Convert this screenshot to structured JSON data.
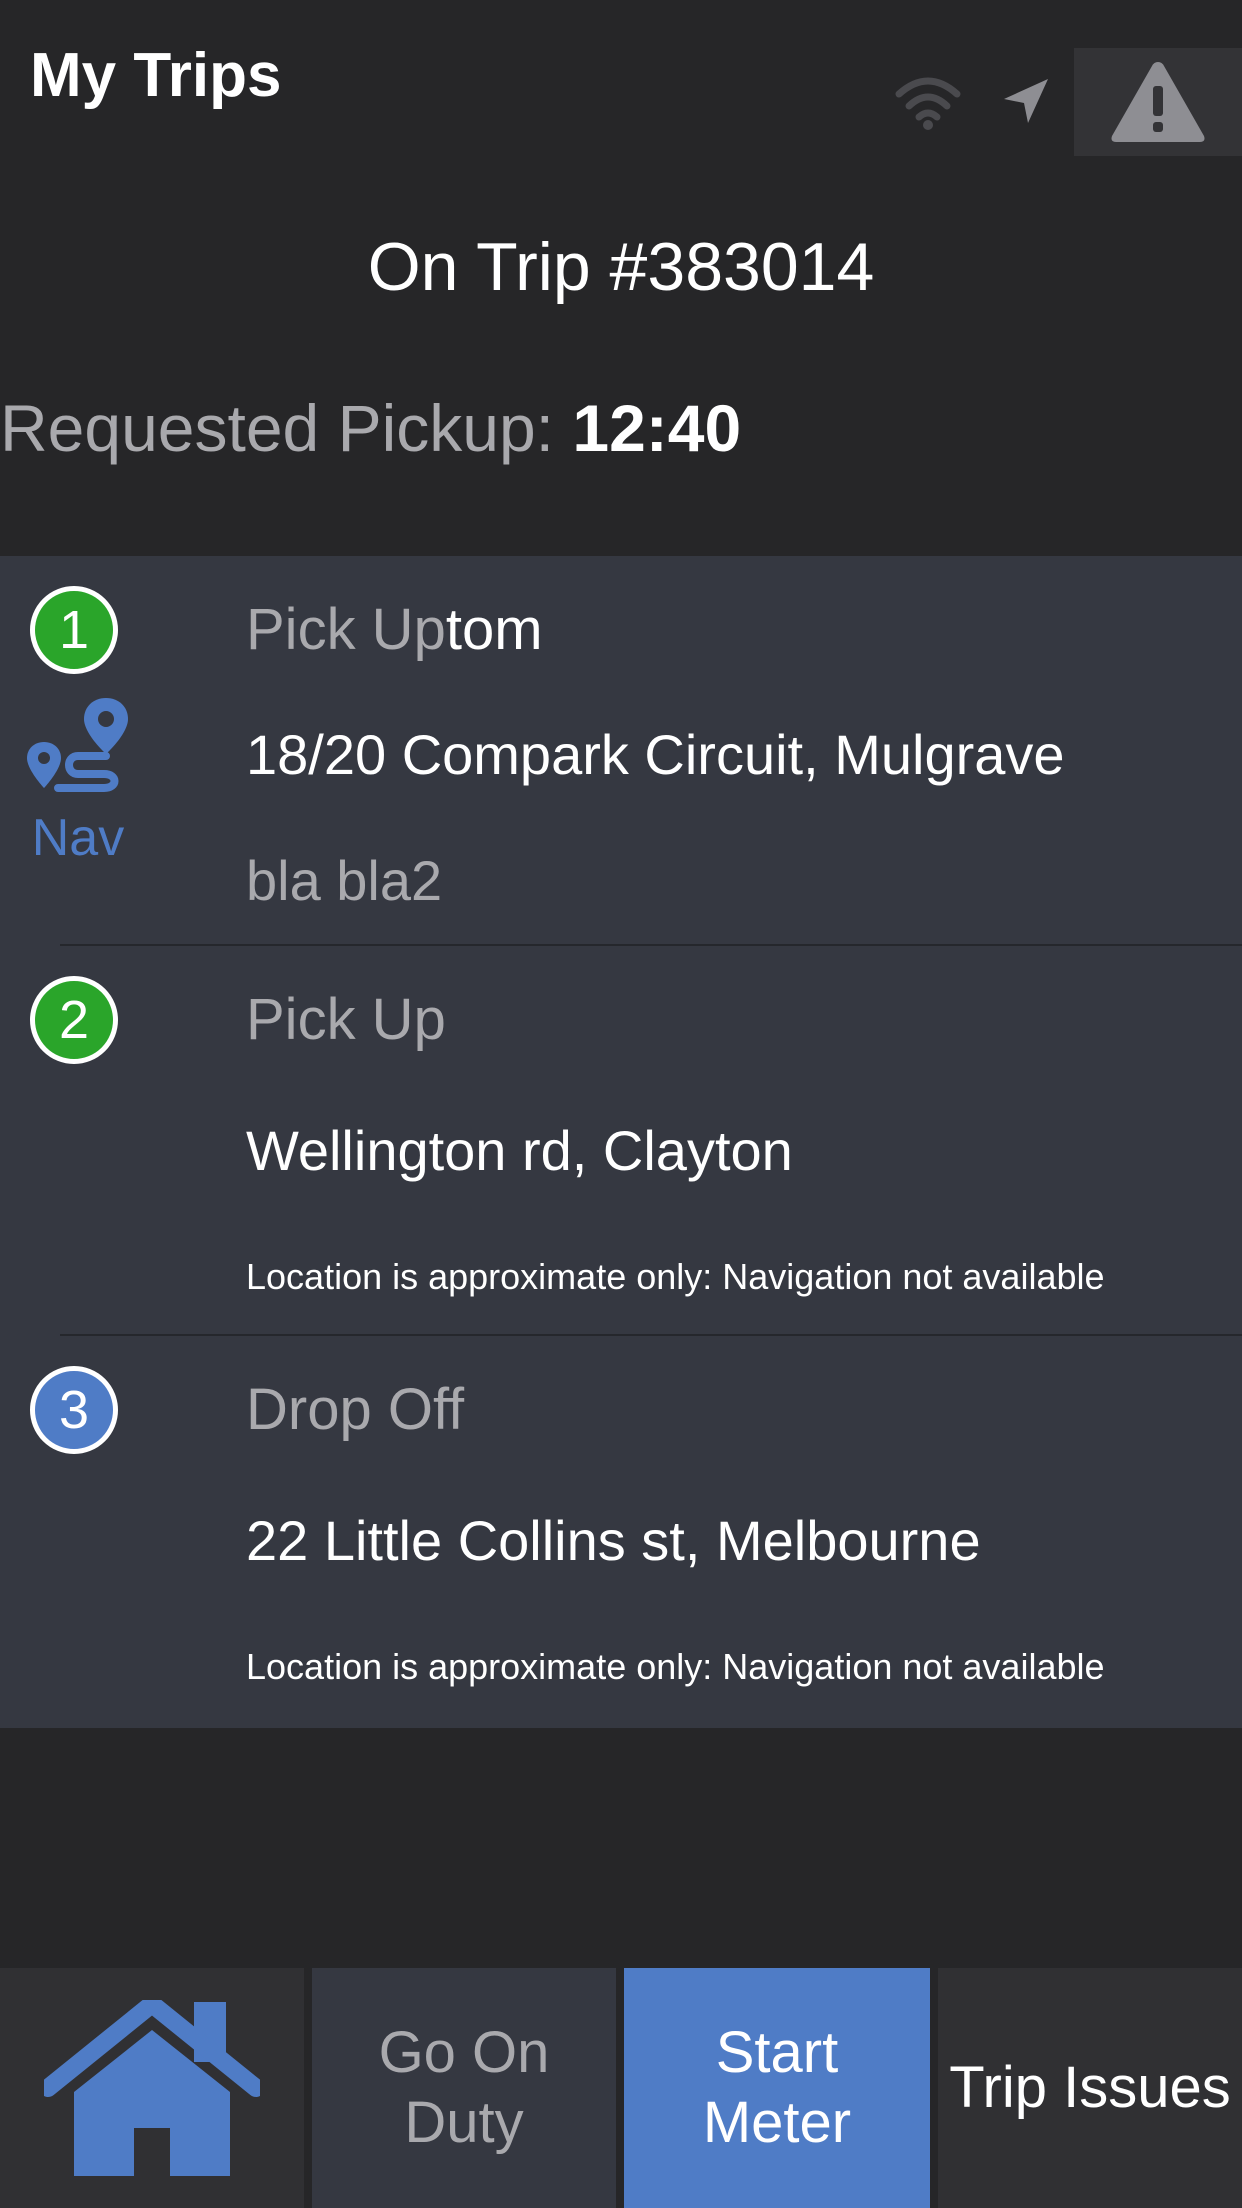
{
  "header": {
    "title": "My Trips",
    "icons": [
      "wifi-icon",
      "location-arrow-icon",
      "alert-triangle-icon"
    ]
  },
  "trip": {
    "heading": "On Trip #383014",
    "requested_label": "Requested Pickup:",
    "requested_time": "12:40"
  },
  "stops": [
    {
      "number": "1",
      "type": "Pick Up",
      "name": "tom",
      "address": "18/20 Compark Circuit, Mulgrave",
      "note": "bla bla2",
      "nav_label": "Nav",
      "badge_color": "#2aa52a"
    },
    {
      "number": "2",
      "type": "Pick Up",
      "address": "Wellington rd, Clayton",
      "note": "Location is approximate only: Navigation not available",
      "badge_color": "#2aa52a"
    },
    {
      "number": "3",
      "type": "Drop Off",
      "address": "22 Little Collins st, Melbourne",
      "note": "Location is approximate only: Navigation not available",
      "badge_color": "#4f7cc6"
    }
  ],
  "bottom_bar": {
    "home_icon": "home-icon",
    "duty_line1": "Go On",
    "duty_line2": "Duty",
    "meter_line1": "Start",
    "meter_line2": "Meter",
    "issues_label": "Trip Issues"
  },
  "colors": {
    "background": "#262628",
    "panel": "#353841",
    "accent_blue": "#4f7cc6",
    "green": "#2aa52a",
    "muted_text": "#a9a9ad"
  }
}
